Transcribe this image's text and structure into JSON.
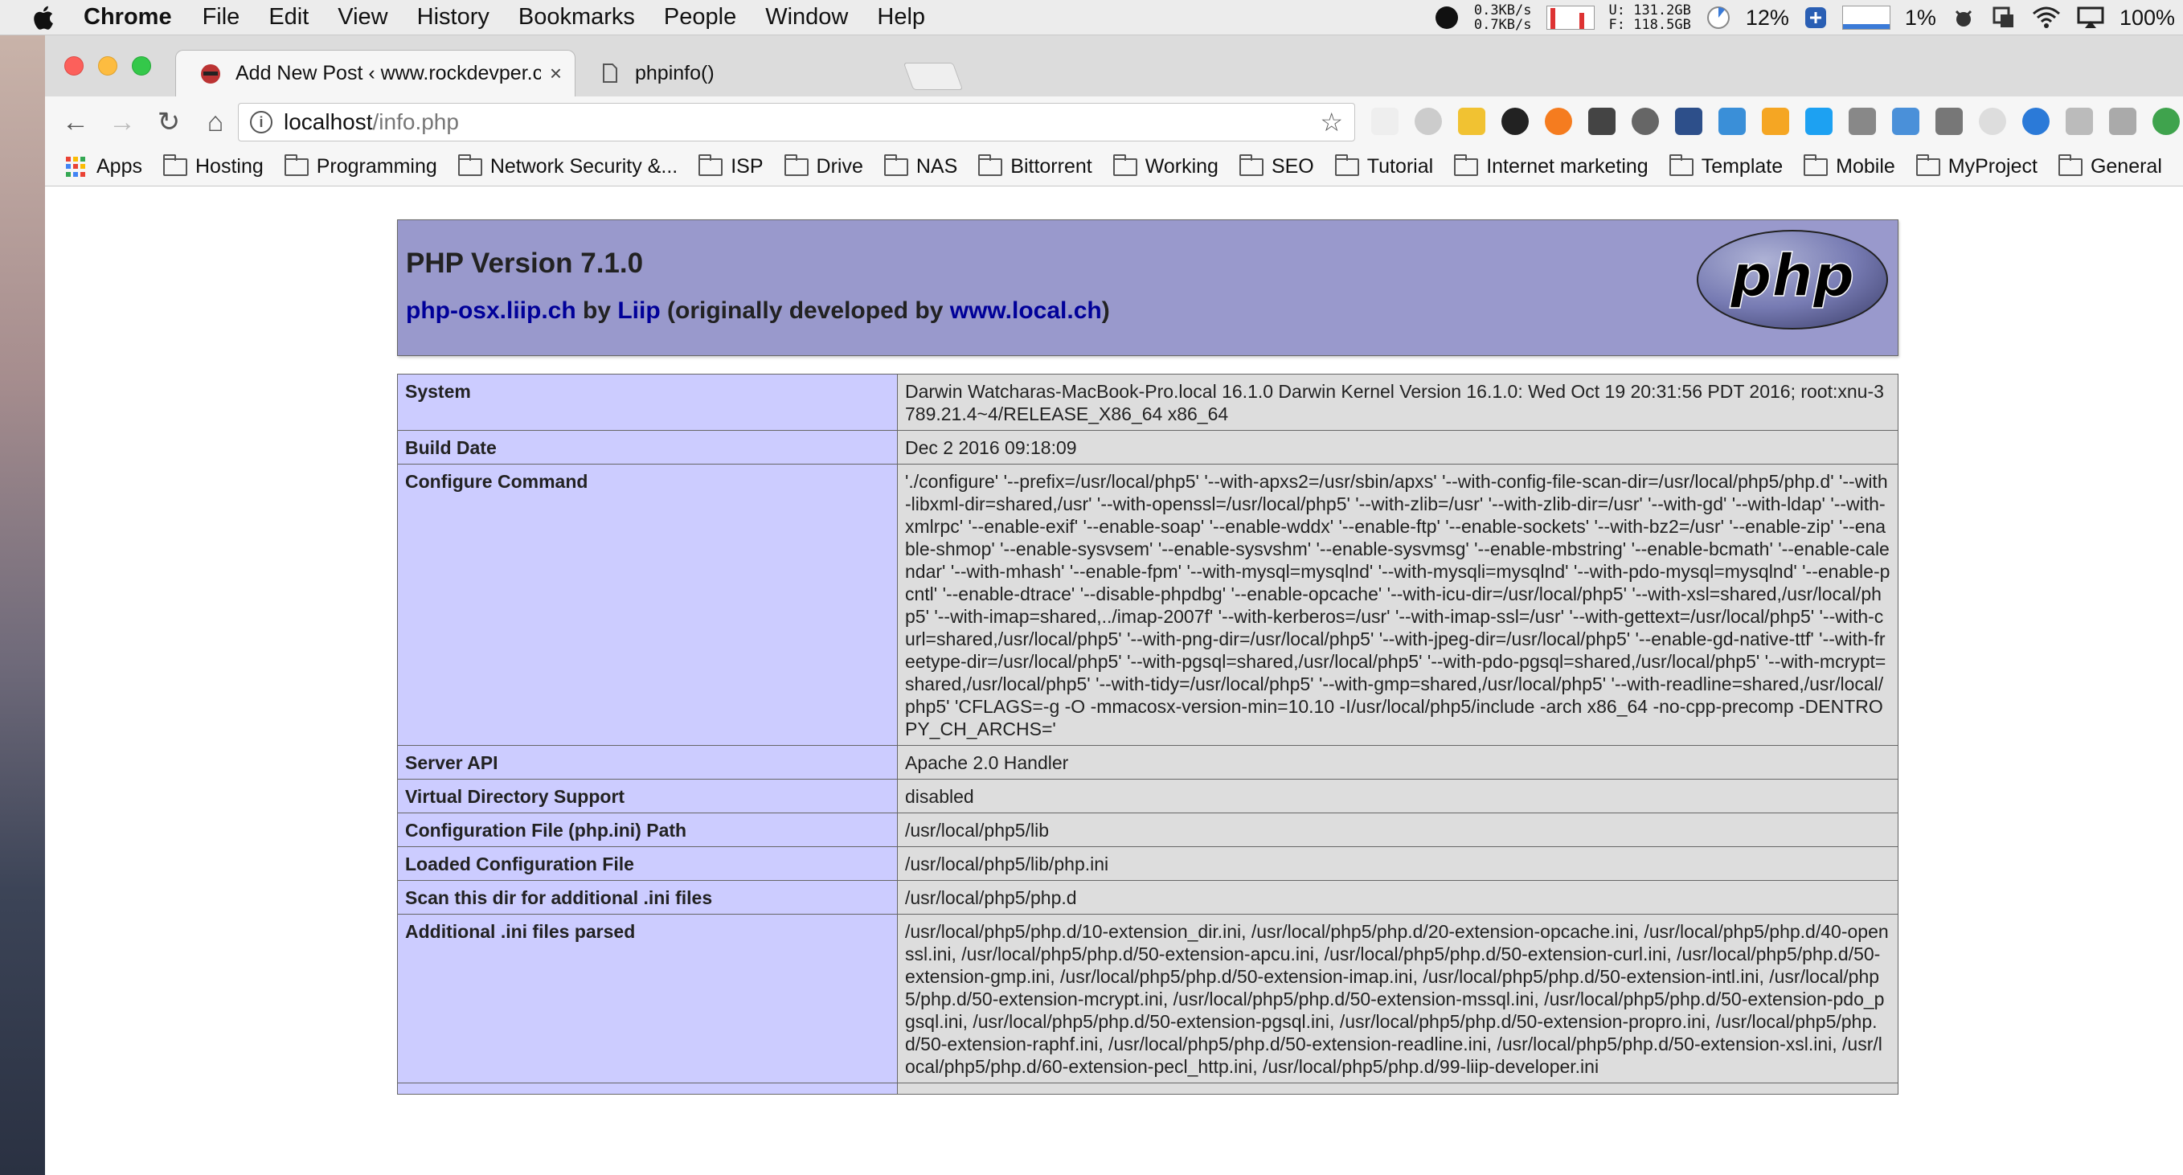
{
  "menubar": {
    "app_name": "Chrome",
    "menus": [
      "File",
      "Edit",
      "View",
      "History",
      "Bookmarks",
      "People",
      "Window",
      "Help"
    ],
    "net_up": "0.3KB/s",
    "net_down": "0.7KB/s",
    "disk_used": "U: 131.2GB",
    "disk_free": "F: 118.5GB",
    "cpu_percent": "12%",
    "mem_percent": "1%",
    "battery": "100%"
  },
  "tabs": [
    {
      "title": "Add New Post ‹ www.rockdevper.com — WordPress",
      "close": "×",
      "active": true
    },
    {
      "title": "phpinfo()",
      "close": "×",
      "active": false
    }
  ],
  "toolbar": {
    "back": "←",
    "forward": "→",
    "reload": "↻",
    "home": "⌂",
    "url_host": "localhost",
    "url_path": "/info.php",
    "star": "☆"
  },
  "bookmarks": {
    "apps": "Apps",
    "items": [
      "Hosting",
      "Programming",
      "Network Security &...",
      "ISP",
      "Drive",
      "NAS",
      "Bittorrent",
      "Working",
      "SEO",
      "Tutorial",
      "Internet marketing",
      "Template",
      "Mobile",
      "MyProject",
      "General"
    ]
  },
  "php": {
    "version": "PHP Version 7.1.0",
    "credit_link1": "php-osx.liip.ch",
    "credit_by": " by ",
    "credit_link2": "Liip",
    "credit_mid": " (originally developed by ",
    "credit_link3": "www.local.ch",
    "credit_end": ")",
    "logo_text": "php"
  },
  "info_rows": [
    {
      "key": "System",
      "value": "Darwin Watcharas-MacBook-Pro.local 16.1.0 Darwin Kernel Version 16.1.0: Wed Oct 19 20:31:56 PDT 2016; root:xnu-3789.21.4~4/RELEASE_X86_64 x86_64"
    },
    {
      "key": "Build Date",
      "value": "Dec 2 2016 09:18:09"
    },
    {
      "key": "Configure Command",
      "value": "'./configure' '--prefix=/usr/local/php5' '--with-apxs2=/usr/sbin/apxs' '--with-config-file-scan-dir=/usr/local/php5/php.d' '--with-libxml-dir=shared,/usr' '--with-openssl=/usr/local/php5' '--with-zlib=/usr' '--with-zlib-dir=/usr' '--with-gd' '--with-ldap' '--with-xmlrpc' '--enable-exif' '--enable-soap' '--enable-wddx' '--enable-ftp' '--enable-sockets' '--with-bz2=/usr' '--enable-zip' '--enable-shmop' '--enable-sysvsem' '--enable-sysvshm' '--enable-sysvmsg' '--enable-mbstring' '--enable-bcmath' '--enable-calendar' '--with-mhash' '--enable-fpm' '--with-mysql=mysqlnd' '--with-mysqli=mysqlnd' '--with-pdo-mysql=mysqlnd' '--enable-pcntl' '--enable-dtrace' '--disable-phpdbg' '--enable-opcache' '--with-icu-dir=/usr/local/php5' '--with-xsl=shared,/usr/local/php5' '--with-imap=shared,../imap-2007f' '--with-kerberos=/usr' '--with-imap-ssl=/usr' '--with-gettext=/usr/local/php5' '--with-curl=shared,/usr/local/php5' '--with-png-dir=/usr/local/php5' '--with-jpeg-dir=/usr/local/php5' '--enable-gd-native-ttf' '--with-freetype-dir=/usr/local/php5' '--with-pgsql=shared,/usr/local/php5' '--with-pdo-pgsql=shared,/usr/local/php5' '--with-mcrypt=shared,/usr/local/php5' '--with-tidy=/usr/local/php5' '--with-gmp=shared,/usr/local/php5' '--with-readline=shared,/usr/local/php5' 'CFLAGS=-g -O -mmacosx-version-min=10.10 -I/usr/local/php5/include -arch x86_64 -no-cpp-precomp -DENTROPY_CH_ARCHS='"
    },
    {
      "key": "Server API",
      "value": "Apache 2.0 Handler"
    },
    {
      "key": "Virtual Directory Support",
      "value": "disabled"
    },
    {
      "key": "Configuration File (php.ini) Path",
      "value": "/usr/local/php5/lib"
    },
    {
      "key": "Loaded Configuration File",
      "value": "/usr/local/php5/lib/php.ini"
    },
    {
      "key": "Scan this dir for additional .ini files",
      "value": "/usr/local/php5/php.d"
    },
    {
      "key": "Additional .ini files parsed",
      "value": "/usr/local/php5/php.d/10-extension_dir.ini, /usr/local/php5/php.d/20-extension-opcache.ini, /usr/local/php5/php.d/40-openssl.ini, /usr/local/php5/php.d/50-extension-apcu.ini, /usr/local/php5/php.d/50-extension-curl.ini, /usr/local/php5/php.d/50-extension-gmp.ini, /usr/local/php5/php.d/50-extension-imap.ini, /usr/local/php5/php.d/50-extension-intl.ini, /usr/local/php5/php.d/50-extension-mcrypt.ini, /usr/local/php5/php.d/50-extension-mssql.ini, /usr/local/php5/php.d/50-extension-pdo_pgsql.ini, /usr/local/php5/php.d/50-extension-pgsql.ini, /usr/local/php5/php.d/50-extension-propro.ini, /usr/local/php5/php.d/50-extension-raphf.ini, /usr/local/php5/php.d/50-extension-readline.ini, /usr/local/php5/php.d/50-extension-xsl.ini, /usr/local/php5/php.d/60-extension-pecl_http.ini, /usr/local/php5/php.d/99-liip-developer.ini"
    },
    {
      "key": "",
      "value": ""
    }
  ],
  "colors": {
    "php_header_bg": "#9999cc",
    "key_cell_bg": "#ccccff",
    "value_cell_bg": "#dddddd",
    "link_color": "#000099"
  }
}
